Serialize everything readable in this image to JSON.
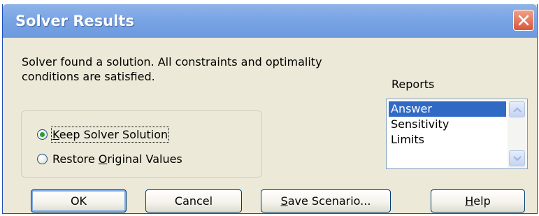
{
  "window": {
    "title": "Solver Results",
    "close_icon": "close-icon"
  },
  "message": {
    "line1": "Solver found a solution.  All constraints and optimality",
    "line2": "conditions are satisfied."
  },
  "options": {
    "keep": {
      "prefix": "",
      "accel": "K",
      "suffix": "eep Solver Solution",
      "checked": true
    },
    "restore": {
      "prefix": "Restore ",
      "accel": "O",
      "suffix": "riginal Values",
      "checked": false
    }
  },
  "reports": {
    "label": "Reports",
    "items": [
      "Answer",
      "Sensitivity",
      "Limits"
    ],
    "selected": "Answer"
  },
  "buttons": {
    "ok": "OK",
    "cancel": "Cancel",
    "save_scenario": {
      "accel": "S",
      "suffix": "ave Scenario..."
    },
    "help": {
      "accel": "H",
      "suffix": "elp"
    }
  },
  "colors": {
    "titlebar": "#7aa5e4",
    "selection": "#316ac5",
    "radio_dot": "#2e9b2e"
  }
}
